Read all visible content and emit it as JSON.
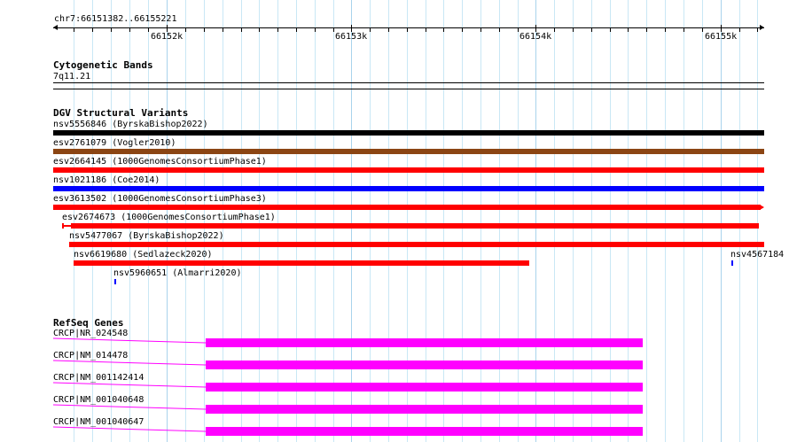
{
  "ruler": {
    "position_label": "chr7:66151382..66155221",
    "ticks": [
      "66152k",
      "66153k",
      "66154k",
      "66155k"
    ]
  },
  "cytoband": {
    "title": "Cytogenetic Bands",
    "band": "7q11.21"
  },
  "dgv": {
    "title": "DGV Structural Variants",
    "variants": [
      {
        "label": "nsv5556846 (ByrskaBishop2022)",
        "color": "#000000"
      },
      {
        "label": "esv2761079 (Vogler2010)",
        "color": "#8b4513"
      },
      {
        "label": "esv2664145 (1000GenomesConsortiumPhase1)",
        "color": "#ff0000"
      },
      {
        "label": "nsv1021186 (Coe2014)",
        "color": "#0000ff"
      },
      {
        "label": "esv3613502 (1000GenomesConsortiumPhase3)",
        "color": "#ff0000"
      },
      {
        "label": "esv2674673 (1000GenomesConsortiumPhase1)",
        "color": "#ff0000"
      },
      {
        "label": "nsv5477067 (ByrskaBishop2022)",
        "color": "#ff0000"
      },
      {
        "label": "nsv6619680 (Sedlazeck2020)",
        "color": "#ff0000"
      },
      {
        "label": "nsv4567184",
        "color": "#0000ff"
      },
      {
        "label": "nsv5960651 (Almarri2020)",
        "color": "#0000ff"
      }
    ]
  },
  "refseq": {
    "title": "RefSeq Genes",
    "genes": [
      {
        "label": "CRCP|NR_024548",
        "color": "#ff00ff"
      },
      {
        "label": "CRCP|NM_014478",
        "color": "#ff00ff"
      },
      {
        "label": "CRCP|NM_001142414",
        "color": "#ff00ff"
      },
      {
        "label": "CRCP|NM_001040648",
        "color": "#ff00ff"
      },
      {
        "label": "CRCP|NM_001040647",
        "color": "#ff00ff"
      }
    ]
  }
}
